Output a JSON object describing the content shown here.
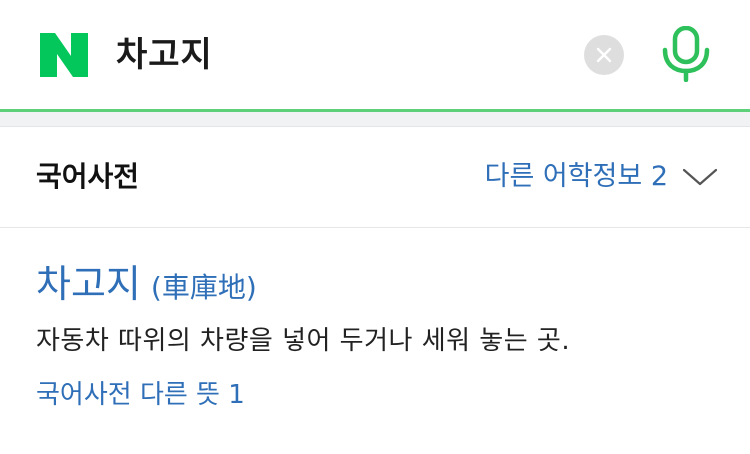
{
  "search": {
    "query": "차고지",
    "logo_letter": "N",
    "clear_icon": "close-icon",
    "mic_icon": "microphone-icon"
  },
  "colors": {
    "brand_green": "#03c75a",
    "link_blue": "#2f6fb8",
    "divider_green": "#5fd07a"
  },
  "section": {
    "title": "국어사전",
    "other_info_label": "다른 어학정보 2",
    "expand_icon": "chevron-down-icon"
  },
  "entry": {
    "headword": "차고지",
    "hanja": "(車庫地)",
    "definition": "자동차 따위의 차량을 넣어 두거나 세워 놓는 곳.",
    "more_link": "국어사전 다른 뜻 1"
  }
}
